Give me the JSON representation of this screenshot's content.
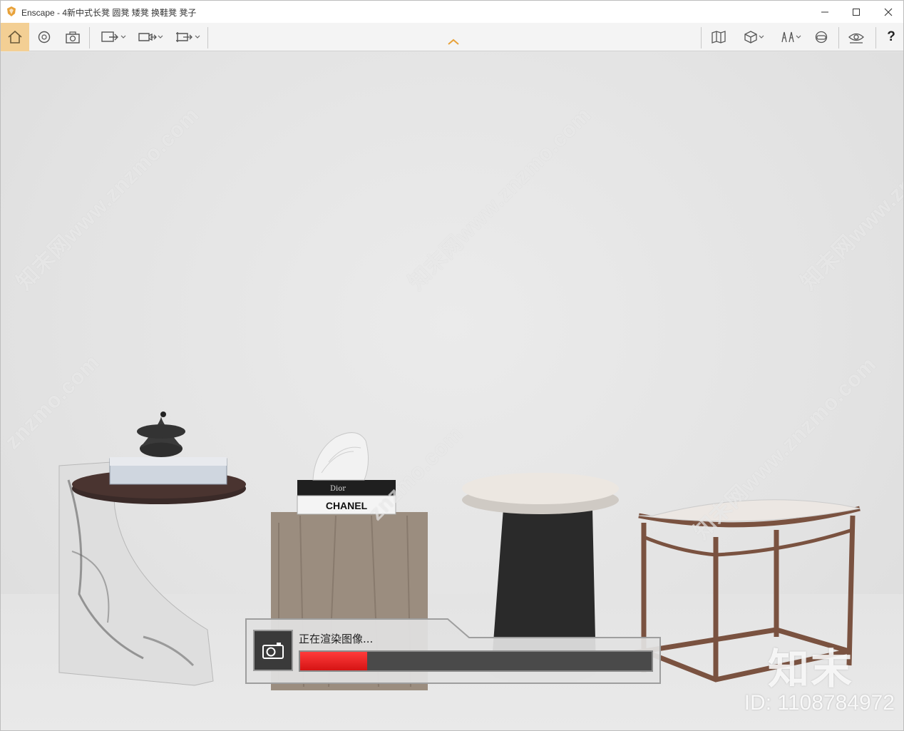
{
  "window": {
    "title": "Enscape - 4新中式长凳 圆凳 矮凳 换鞋凳 凳子",
    "controls": [
      "minimize",
      "maximize",
      "close"
    ]
  },
  "toolbar": {
    "left_icons": [
      "home-icon",
      "globe-camera-icon",
      "screenshot-camera-icon",
      "export-batch-icon",
      "export-video-icon",
      "export-panorama-icon"
    ],
    "right_icons": [
      "map-icon",
      "cube-view-icon",
      "asset-library-icon",
      "vr-headset-icon",
      "visual-settings-icon"
    ],
    "help_label": "?",
    "accent_color": "#f3cf94"
  },
  "watermark": {
    "site_text": "知末网www.znzmo.com",
    "site_text_short": "znzmo.com",
    "brand": "知末",
    "id_text": "ID: 1108784972"
  },
  "render_dialog": {
    "label": "正在渲染图像...",
    "progress": 0.19,
    "progress_color": "#e41e1e"
  },
  "scene": {
    "book_text_top": "Dior",
    "book_text_bottom": "CHANEL"
  }
}
